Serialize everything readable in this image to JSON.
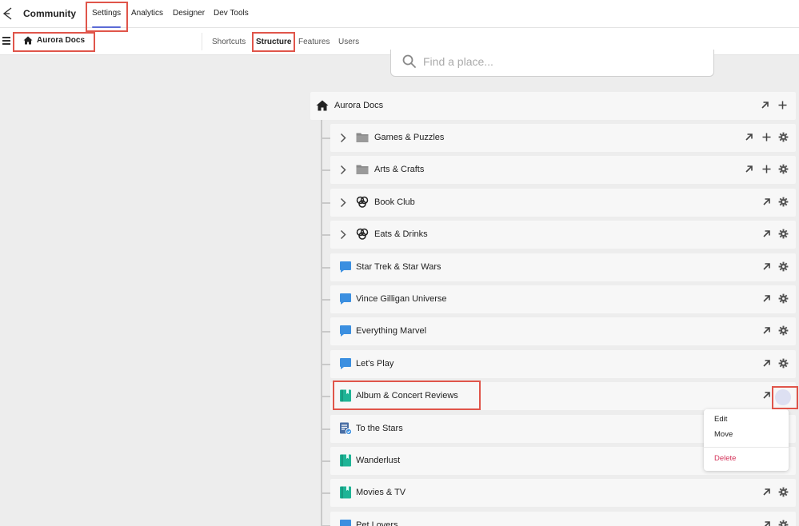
{
  "app": {
    "title": "Community",
    "nav_tabs": [
      {
        "label": "Settings",
        "active": true
      },
      {
        "label": "Analytics",
        "active": false
      },
      {
        "label": "Designer",
        "active": false
      },
      {
        "label": "Dev Tools",
        "active": false
      }
    ]
  },
  "subnav": {
    "breadcrumb": "Aurora Docs",
    "tabs": [
      {
        "label": "Shortcuts",
        "active": false
      },
      {
        "label": "Structure",
        "active": true
      },
      {
        "label": "Features",
        "active": false
      },
      {
        "label": "Users",
        "active": false
      }
    ]
  },
  "search": {
    "placeholder": "Find a place..."
  },
  "tree": {
    "root": {
      "label": "Aurora Docs",
      "icon": "home-icon"
    },
    "items": [
      {
        "label": "Games & Puzzles",
        "icon": "folder-icon",
        "expandable": true,
        "actions": [
          "open",
          "add",
          "settings"
        ]
      },
      {
        "label": "Arts & Crafts",
        "icon": "folder-icon",
        "expandable": true,
        "actions": [
          "open",
          "add",
          "settings"
        ]
      },
      {
        "label": "Book Club",
        "icon": "group-hub-icon",
        "expandable": true,
        "actions": [
          "open",
          "settings"
        ]
      },
      {
        "label": "Eats & Drinks",
        "icon": "group-hub-icon",
        "expandable": true,
        "actions": [
          "open",
          "settings"
        ]
      },
      {
        "label": "Star Trek & Star Wars",
        "icon": "forum-icon",
        "expandable": false,
        "actions": [
          "open",
          "settings"
        ]
      },
      {
        "label": "Vince Gilligan Universe",
        "icon": "forum-icon",
        "expandable": false,
        "actions": [
          "open",
          "settings"
        ]
      },
      {
        "label": "Everything Marvel",
        "icon": "forum-icon",
        "expandable": false,
        "actions": [
          "open",
          "settings"
        ]
      },
      {
        "label": "Let's Play",
        "icon": "forum-icon",
        "expandable": false,
        "actions": [
          "open",
          "settings"
        ]
      },
      {
        "label": "Album & Concert Reviews",
        "icon": "blog-icon",
        "expandable": false,
        "actions": [
          "open",
          "settings"
        ]
      },
      {
        "label": "To the Stars",
        "icon": "knowledge-base-icon",
        "expandable": false,
        "actions": []
      },
      {
        "label": "Wanderlust",
        "icon": "blog-icon",
        "expandable": false,
        "actions": []
      },
      {
        "label": "Movies & TV",
        "icon": "blog-icon",
        "expandable": false,
        "actions": [
          "open",
          "settings"
        ]
      },
      {
        "label": "Pet Lovers",
        "icon": "forum-icon",
        "expandable": false,
        "actions": [
          "open",
          "settings"
        ]
      }
    ]
  },
  "dropdown": {
    "items": [
      {
        "label": "Edit"
      },
      {
        "label": "Move"
      },
      {
        "label": "Delete"
      }
    ]
  },
  "colors": {
    "accent": "#5b6bd6",
    "highlight": "#e0554a",
    "forum": "#3b8fe0",
    "blog": "#1fb496",
    "kb": "#4a6fa5",
    "danger": "#d4345a"
  }
}
